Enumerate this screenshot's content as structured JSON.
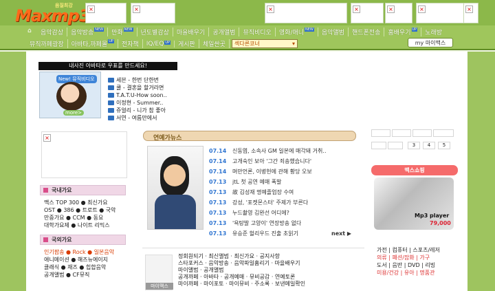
{
  "header": {
    "logo_small": "음질최강",
    "logo_main": "Maxmp3"
  },
  "menu": {
    "row1": [
      "음악감상",
      "음악방송",
      "만화",
      "년도별감상",
      "마을배우기",
      "공개앨범",
      "뮤직비디오",
      "영화/애니",
      "음악앨범",
      "핸드폰전송",
      "홈배우기",
      "노래방"
    ],
    "row2": [
      "뮤직까페광장",
      "아바타,까페몰",
      "전자책",
      "IQ/EQ",
      "게시판",
      "체일싼곳"
    ],
    "row1_badges": [
      "NEW",
      "NEW",
      "NEW",
      "NEW",
      "UP",
      "NEW"
    ],
    "row2_badges": [
      "UP",
      "UP",
      "UP"
    ],
    "select_label": "섹다른코너",
    "my_button": "마이맥스"
  },
  "promo": {
    "title": "내사진 아바타로 우표를 만드세요!",
    "label": "New! 뮤직비디오",
    "more": "more>",
    "lines": [
      "세븐 - 한번 단한번",
      "쿨 - 결혼을 할거라면",
      "T.A.T.U-How soon..",
      "이정현 - Summer..",
      "쥬얼리 - 니가 참 좋아",
      "서연 - 여름만에서"
    ]
  },
  "left_sections": [
    {
      "title": "국내가요",
      "rows": [
        "맥스 TOP 300 ● 최신가요",
        "OST ● 386 ● 트로트 ● 국악",
        "만중가요 ● CCM ● 동요",
        "대학가요제 ● 나이트 리믹스"
      ]
    },
    {
      "title": "국외가요",
      "rows": [
        "인기팝송 ● Rock ● 일본음악",
        "애니메이션 ● 해즈뉴에이지",
        "클래식 ● 재즈 ● 힙합음악",
        "공개앨범 ● CF뮤직"
      ]
    }
  ],
  "news": {
    "title": "연예가뉴스",
    "items": [
      {
        "date": "07.14",
        "text": "신동엽, 소속사 GM 일본에 매각돼 거취.."
      },
      {
        "date": "07.14",
        "text": "고개숙인 보아 '그간 죄송했습니다'"
      },
      {
        "date": "07.14",
        "text": "며만언론, 이병헌에 관해 황당 오보"
      },
      {
        "date": "07.13",
        "text": "jtL 첫 공연 예매 폭발"
      },
      {
        "date": "07.13",
        "text": "故 김성재 명예졸업장 수여"
      },
      {
        "date": "07.13",
        "text": "강성, '포켓몬스터' 주제가 부른다"
      },
      {
        "date": "07.13",
        "text": "누드촬영 김완선 어디에?"
      },
      {
        "date": "07.13",
        "text": "'욕탕발 고양이' 연장방송 없다"
      },
      {
        "date": "07.13",
        "text": "유승준 헐리우드 진출 초읽기"
      }
    ],
    "next": "next ▶"
  },
  "lower": {
    "tab": "마이맥스",
    "lines": [
      "정회원되기 · 최신앨범 · 최신가요 · 공지사항",
      "스타포커스 · 음악방송 · 음악파일훔리기 · 마을배우기",
      "마이앨범 · 공개앨범",
      "공개까페 · 아바타 · 공개예매 · 뮤비공감 · 연예토론",
      "마이까페 · 마이포토 · 마이뮤비 · 주소록 · 보낸메일확인"
    ]
  },
  "right": {
    "pages": [
      "3",
      "4",
      "5"
    ],
    "shop_title": "맥스쇼핑",
    "product": "Mp3 player",
    "price": "79,000",
    "cats": [
      "가전 | 컴퓨터 | 스포츠/레저",
      "의류 | 패션/잡화 | 가구",
      "도서 | 음반 | DVD | 리빙",
      "미용/건강 | 유아 | 명품관"
    ]
  }
}
